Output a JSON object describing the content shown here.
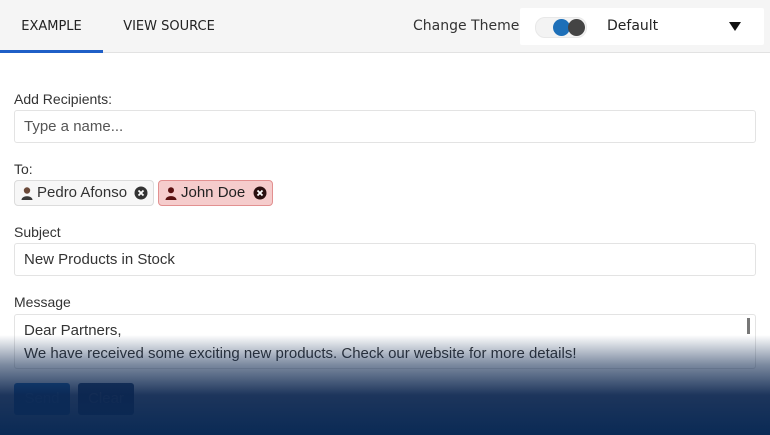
{
  "tabs": {
    "example": "EXAMPLE",
    "view_source": "VIEW SOURCE"
  },
  "theme": {
    "label": "Change Theme",
    "value": "Default",
    "toggle_colors": [
      "#1d6fb8",
      "#444444"
    ]
  },
  "recipients": {
    "label": "Add Recipients:",
    "placeholder": "Type a name..."
  },
  "to": {
    "label": "To:",
    "chips": [
      {
        "name": "Pedro Afonso",
        "icon": "user-photo-icon",
        "state": "normal"
      },
      {
        "name": "John Doe",
        "icon": "user-icon",
        "state": "error",
        "color": "#f5cccc"
      }
    ],
    "remove_icon": "close-circle-icon"
  },
  "subject": {
    "label": "Subject",
    "value": "New Products in Stock"
  },
  "message": {
    "label": "Message",
    "value": "Dear Partners,\nWe have received some exciting new products. Check our website for more details!"
  },
  "buttons": {
    "send": "Send",
    "clear": "Clear"
  },
  "colors": {
    "accent": "#1f5fc7",
    "overlay": "#0a2a55"
  }
}
